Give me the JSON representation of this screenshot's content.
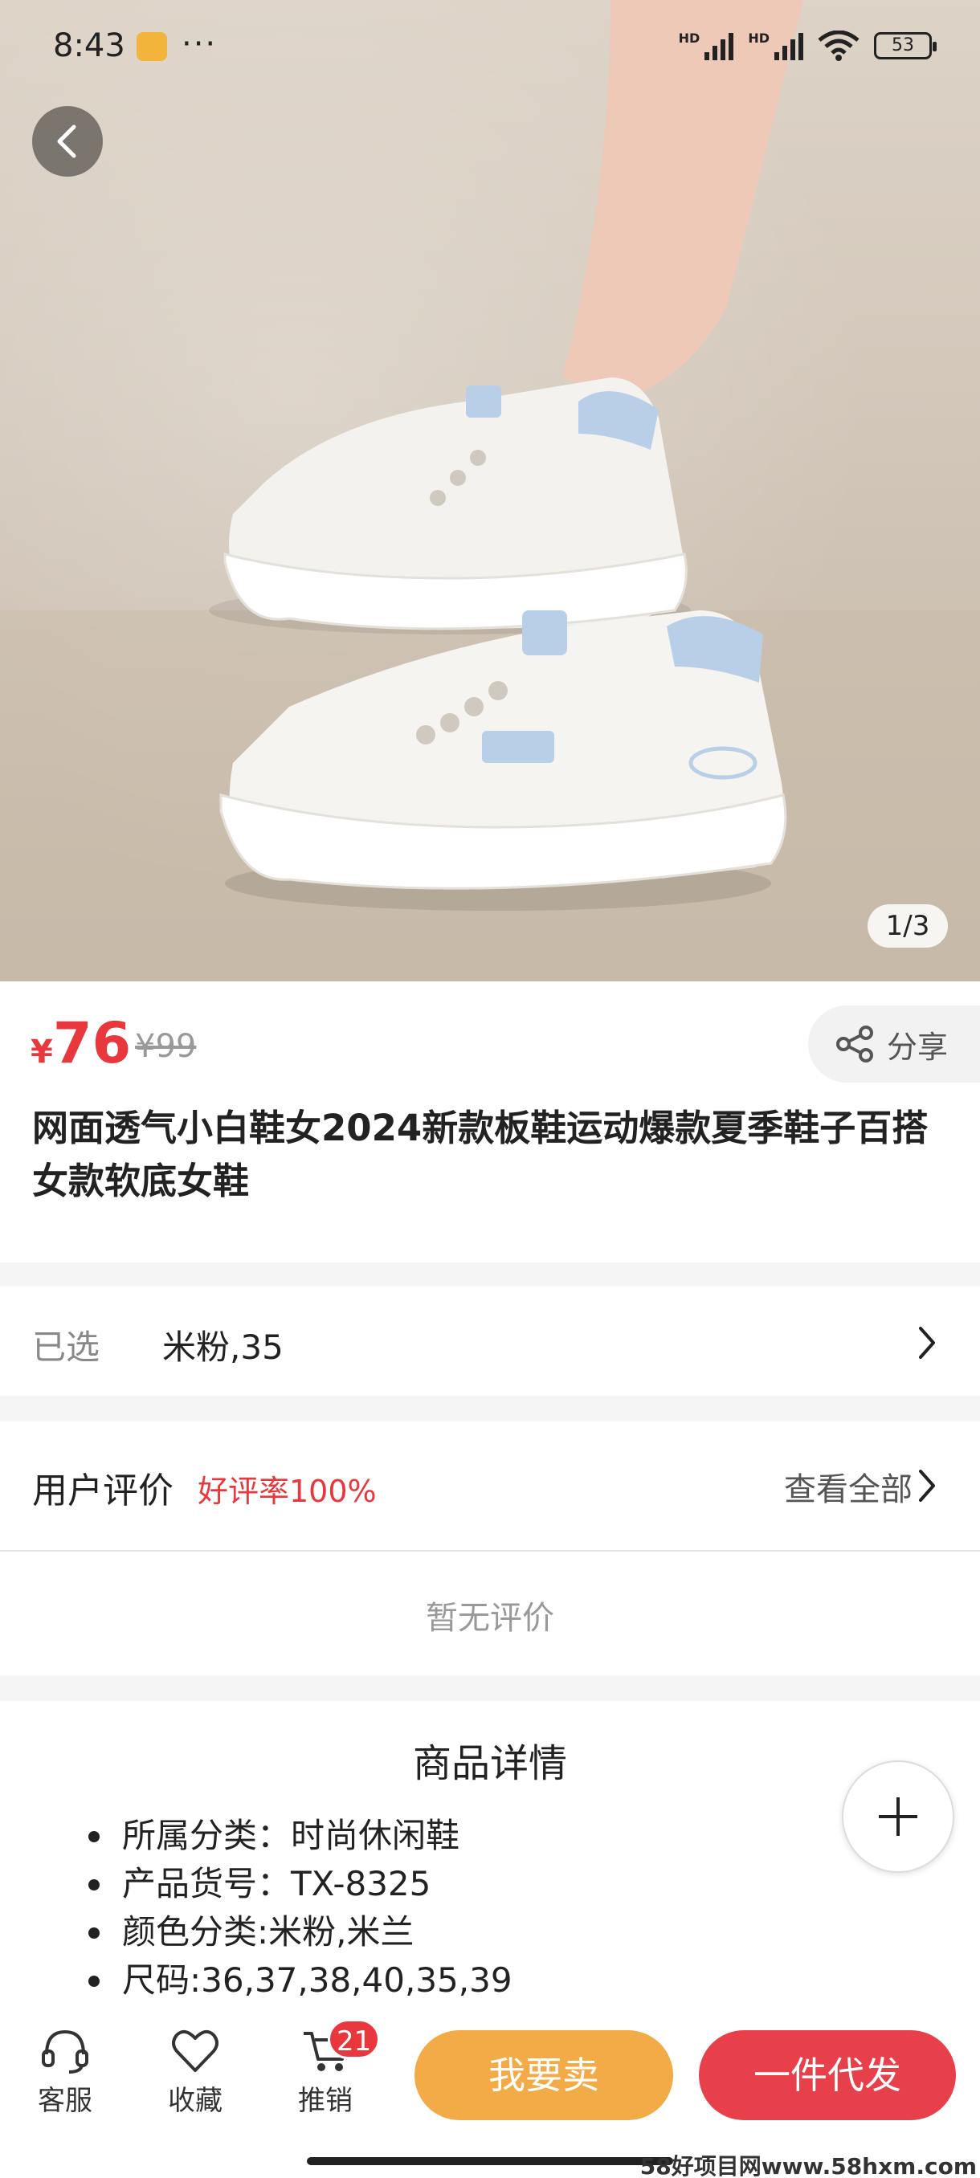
{
  "status_bar": {
    "time": "8:43",
    "dots": "···",
    "battery": "53",
    "hd1": "HD",
    "hd2": "HD"
  },
  "gallery": {
    "counter": "1/3"
  },
  "product": {
    "currency": "¥",
    "price": "76",
    "original_price": "¥99",
    "share_label": "分享",
    "title": "网面透气小白鞋女2024新款板鞋运动爆款夏季鞋子百搭女款软底女鞋"
  },
  "selection": {
    "label": "已选",
    "value": "米粉,35"
  },
  "reviews": {
    "label": "用户评价",
    "rate": "好评率100%",
    "view_all": "查看全部",
    "empty": "暂无评价"
  },
  "details": {
    "title": "商品详情",
    "items": [
      "所属分类：时尚休闲鞋",
      "产品货号：TX-8325",
      "颜色分类:米粉,米兰",
      "尺码:36,37,38,40,35,39"
    ]
  },
  "bottom_bar": {
    "service": "客服",
    "favorite": "收藏",
    "promote": "推销",
    "promote_badge": "21",
    "sell_button": "我要卖",
    "dropship_button": "一件代发"
  },
  "watermark": "58好项目网www.58hxm.com",
  "colors": {
    "accent_red": "#e8383d",
    "sell_orange": "#f2ab47",
    "ship_red": "#e8404a"
  }
}
